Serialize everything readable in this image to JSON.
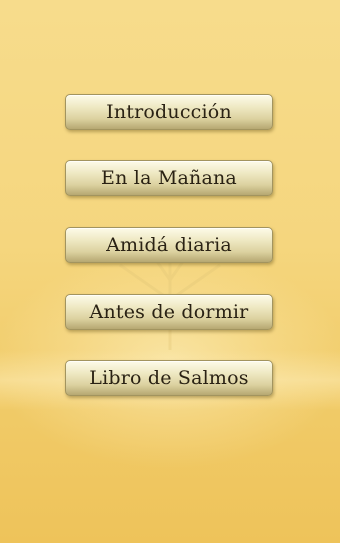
{
  "menu": {
    "items": [
      {
        "label": "Introducción"
      },
      {
        "label": "En la Mañana"
      },
      {
        "label": "Amidá diaria"
      },
      {
        "label": "Antes de dormir"
      },
      {
        "label": "Libro de Salmos"
      }
    ]
  },
  "colors": {
    "background_top": "#f7dc8c",
    "background_bottom": "#eec35a",
    "button_face": "#efe9c4",
    "button_border": "#a2945f",
    "label_text": "#2a2214"
  }
}
